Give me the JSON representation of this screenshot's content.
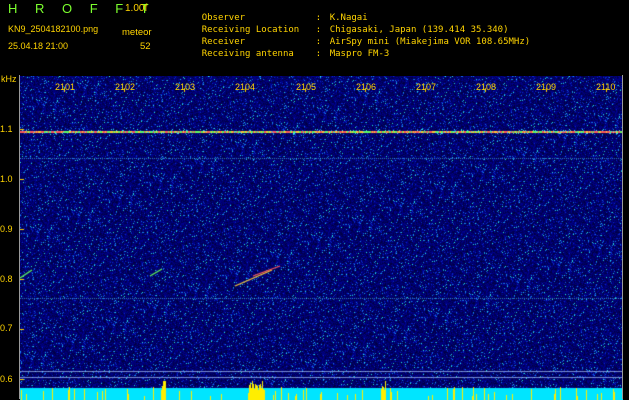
{
  "header": {
    "app_title": "H R O F F T",
    "version": "1.00f",
    "file_name": "KN9_2504182100.png",
    "meteor_label": "meteor",
    "datetime": "25.04.18 21:00",
    "meteor_count": "52"
  },
  "info": [
    {
      "key": "Observer",
      "value": "K.Nagai"
    },
    {
      "key": "Receiving Location",
      "value": "Chigasaki, Japan (139.414 35.340)"
    },
    {
      "key": "Receiver",
      "value": "AirSpy mini (Miakejima VOR 108.65MHz)"
    },
    {
      "key": "Receiving antenna",
      "value": "Maspro FM-3"
    }
  ],
  "axis": {
    "unit": "kHz",
    "y_ticks": [
      "1.1",
      "1.0",
      "0.9",
      "0.8",
      "0.7",
      "0.6"
    ],
    "x_ticks": [
      "2101",
      "2102",
      "2103",
      "2104",
      "2105",
      "2106",
      "2107",
      "2108",
      "2109",
      "2110"
    ]
  },
  "colors": {
    "background": "#000000",
    "label_yellow": "#FFD400",
    "title_green": "#7CFF2E",
    "noise_blue": "#1A25B8",
    "bottom_band": "#00E5FF"
  }
}
